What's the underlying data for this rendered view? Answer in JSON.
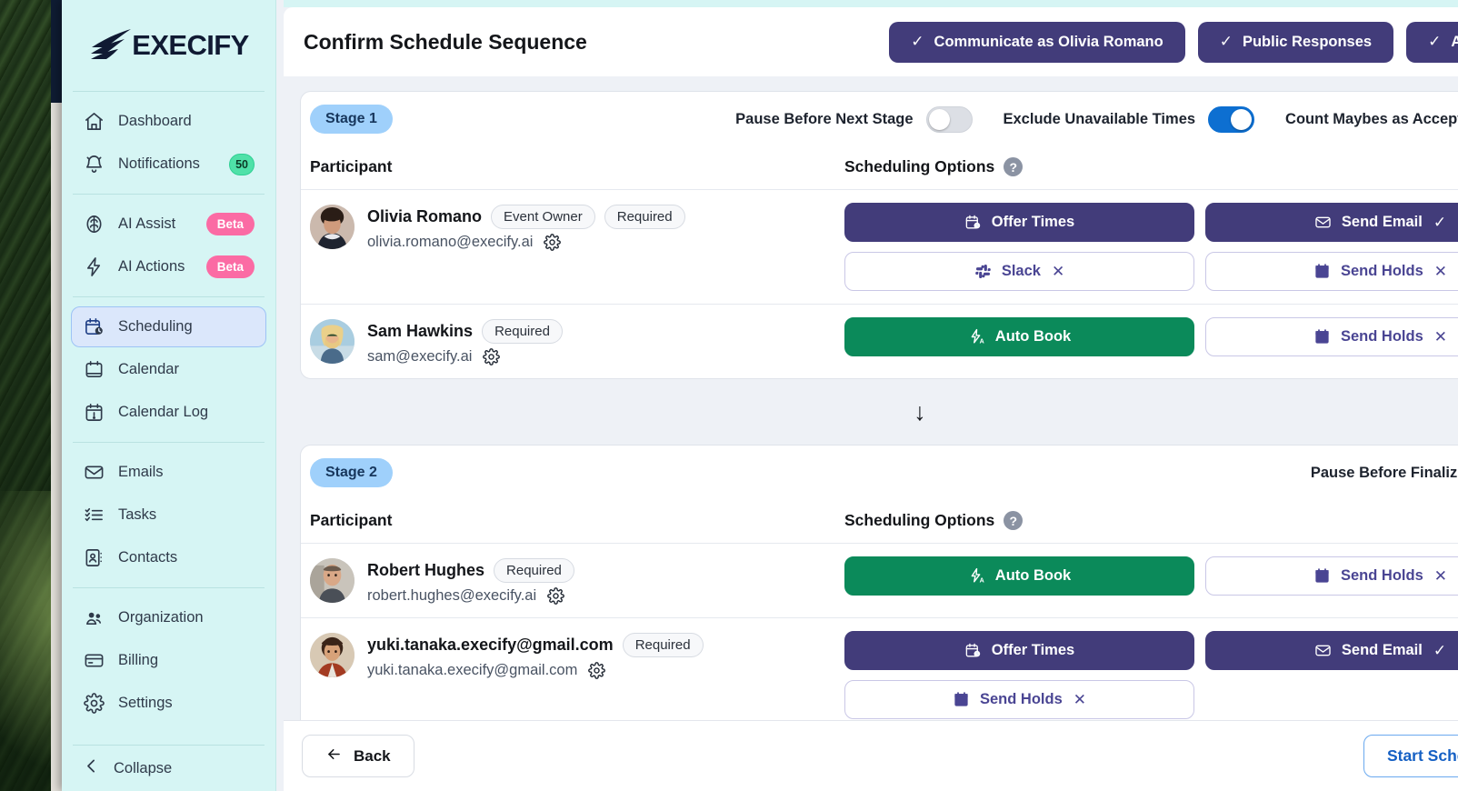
{
  "sidebar": {
    "logo_text": "EXECIFY",
    "groups": [
      {
        "items": [
          {
            "label": "Dashboard",
            "icon": "home-icon",
            "badge": null,
            "badge_type": null,
            "active": false
          },
          {
            "label": "Notifications",
            "icon": "bell-icon",
            "badge": "50",
            "badge_type": "count",
            "active": false
          }
        ]
      },
      {
        "items": [
          {
            "label": "AI Assist",
            "icon": "brain-icon",
            "badge": "Beta",
            "badge_type": "beta",
            "active": false
          },
          {
            "label": "AI Actions",
            "icon": "bolt-icon",
            "badge": "Beta",
            "badge_type": "beta",
            "active": false
          }
        ]
      },
      {
        "items": [
          {
            "label": "Scheduling",
            "icon": "calendar-clock-icon",
            "badge": null,
            "badge_type": null,
            "active": true
          },
          {
            "label": "Calendar",
            "icon": "calendar-icon",
            "badge": null,
            "badge_type": null,
            "active": false
          },
          {
            "label": "Calendar Log",
            "icon": "calendar-alert-icon",
            "badge": null,
            "badge_type": null,
            "active": false
          }
        ]
      },
      {
        "items": [
          {
            "label": "Emails",
            "icon": "envelope-icon",
            "badge": null,
            "badge_type": null,
            "active": false
          },
          {
            "label": "Tasks",
            "icon": "checklist-icon",
            "badge": null,
            "badge_type": null,
            "active": false
          },
          {
            "label": "Contacts",
            "icon": "contact-book-icon",
            "badge": null,
            "badge_type": null,
            "active": false
          }
        ]
      },
      {
        "items": [
          {
            "label": "Organization",
            "icon": "people-icon",
            "badge": null,
            "badge_type": null,
            "active": false
          },
          {
            "label": "Billing",
            "icon": "credit-card-icon",
            "badge": null,
            "badge_type": null,
            "active": false
          },
          {
            "label": "Settings",
            "icon": "gear-icon",
            "badge": null,
            "badge_type": null,
            "active": false
          }
        ]
      }
    ],
    "collapse_label": "Collapse"
  },
  "header": {
    "title": "Confirm Schedule Sequence",
    "actions": [
      {
        "label": "Communicate as Olivia Romano",
        "check": "✓"
      },
      {
        "label": "Public Responses",
        "check": "✓"
      },
      {
        "label": "Add Goo",
        "check": "✓"
      }
    ]
  },
  "stages": [
    {
      "pill": "Stage 1",
      "toggles": [
        {
          "label": "Pause Before Next Stage",
          "on": false
        },
        {
          "label": "Exclude Unavailable Times",
          "on": true
        },
        {
          "label": "Count Maybes as Accepted",
          "on": true
        }
      ],
      "columns": {
        "participant": "Participant",
        "options": "Scheduling Options",
        "help": "?"
      },
      "participants": [
        {
          "name": "Olivia Romano",
          "tags": [
            "Event Owner",
            "Required"
          ],
          "email": "olivia.romano@execify.ai",
          "avatar": "woman-dark-hair",
          "actions_left": [
            {
              "label": "Offer Times",
              "style": "filled-purple",
              "icon": "calendar-clock-icon",
              "mark": ""
            },
            {
              "label": "Slack",
              "style": "outline",
              "icon": "slack-icon",
              "mark": "✕"
            }
          ],
          "actions_right": [
            {
              "label": "Send Email",
              "style": "filled-purple",
              "icon": "envelope-icon",
              "mark": "✓"
            },
            {
              "label": "Send Holds",
              "style": "outline",
              "icon": "calendar-hold-icon",
              "mark": "✕"
            }
          ]
        },
        {
          "name": "Sam Hawkins",
          "tags": [
            "Required"
          ],
          "email": "sam@execify.ai",
          "avatar": "woman-blonde",
          "actions_left": [
            {
              "label": "Auto Book",
              "style": "filled-green",
              "icon": "auto-bolt-icon",
              "mark": ""
            }
          ],
          "actions_right": [
            {
              "label": "Send Holds",
              "style": "outline",
              "icon": "calendar-hold-icon",
              "mark": "✕"
            }
          ]
        }
      ]
    },
    {
      "pill": "Stage 2",
      "toggles": [
        {
          "label": "Pause Before Finalizing",
          "on": false
        }
      ],
      "columns": {
        "participant": "Participant",
        "options": "Scheduling Options",
        "help": "?"
      },
      "participants": [
        {
          "name": "Robert Hughes",
          "tags": [
            "Required"
          ],
          "email": "robert.hughes@execify.ai",
          "avatar": "man-short-hair",
          "actions_left": [
            {
              "label": "Auto Book",
              "style": "filled-green",
              "icon": "auto-bolt-icon",
              "mark": ""
            }
          ],
          "actions_right": [
            {
              "label": "Send Holds",
              "style": "outline",
              "icon": "calendar-hold-icon",
              "mark": "✕"
            }
          ]
        },
        {
          "name": "yuki.tanaka.execify@gmail.com",
          "tags": [
            "Required"
          ],
          "email": "yuki.tanaka.execify@gmail.com",
          "avatar": "woman-red-jacket",
          "actions_left": [
            {
              "label": "Offer Times",
              "style": "filled-purple",
              "icon": "calendar-clock-icon",
              "mark": ""
            },
            {
              "label": "Send Holds",
              "style": "outline",
              "icon": "calendar-hold-icon",
              "mark": "✕"
            }
          ],
          "actions_right": [
            {
              "label": "Send Email",
              "style": "filled-purple",
              "icon": "envelope-icon",
              "mark": "✓"
            }
          ]
        }
      ]
    }
  ],
  "footer": {
    "back_label": "Back",
    "back_icon": "arrow-left-icon",
    "start_label": "Start Schedule N"
  },
  "colors": {
    "sidebar_bg": "#d6f5f4",
    "accent_purple": "#423c7a",
    "accent_green": "#0b8a5a",
    "toggle_on": "#0d6fd1",
    "stage_pill": "#9fd0fb",
    "beta_badge": "#fb6ba4",
    "count_badge": "#4fe1a8",
    "start_link": "#1560c4"
  }
}
